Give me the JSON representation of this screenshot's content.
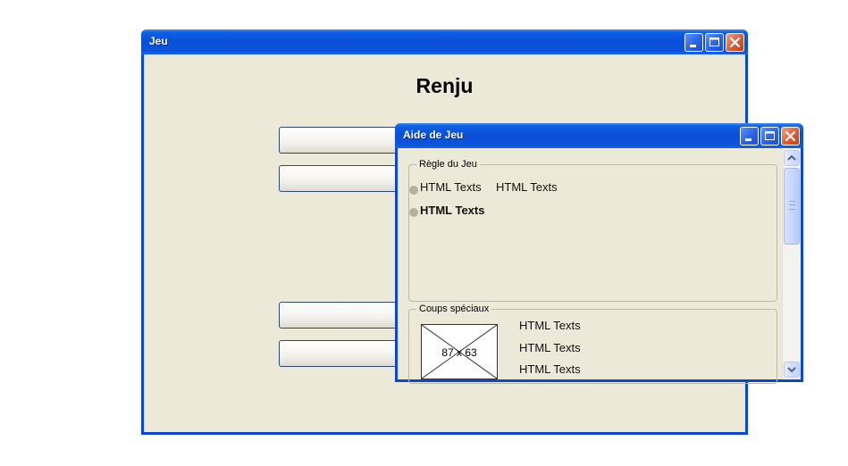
{
  "main_window": {
    "title": "Jeu",
    "heading": "Renju",
    "buttons": [
      "",
      "",
      "",
      ""
    ]
  },
  "help_window": {
    "title": "Aide de Jeu",
    "rules_group": {
      "legend": "Règle du Jeu",
      "items": [
        {
          "label": "HTML Texts",
          "extra": "HTML Texts"
        },
        {
          "label": "HTML Texts"
        }
      ]
    },
    "specials_group": {
      "legend": "Coups spéciaux",
      "image_label": "87 x 63",
      "texts": [
        "HTML Texts",
        "HTML Texts",
        "HTML Texts"
      ]
    }
  },
  "icons": {
    "minimize": "minimize-icon",
    "maximize": "maximize-icon",
    "close": "close-icon",
    "scroll_up": "chevron-up-icon",
    "scroll_down": "chevron-down-icon"
  },
  "colors": {
    "titlebar": "#0a4fd6",
    "window_bg": "#ece9d8",
    "close_button": "#e0623a"
  }
}
